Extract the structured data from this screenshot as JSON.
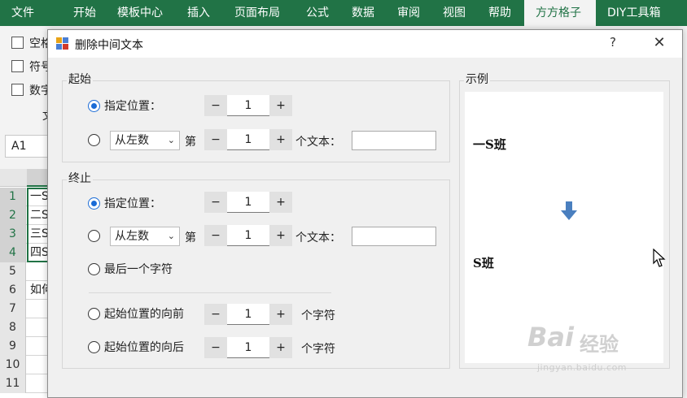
{
  "ribbon": {
    "tabs": [
      {
        "label": "文件",
        "active": false
      },
      {
        "label": "开始",
        "active": false
      },
      {
        "label": "模板中心",
        "active": false
      },
      {
        "label": "插入",
        "active": false
      },
      {
        "label": "页面布局",
        "active": false
      },
      {
        "label": "公式",
        "active": false
      },
      {
        "label": "数据",
        "active": false
      },
      {
        "label": "审阅",
        "active": false
      },
      {
        "label": "视图",
        "active": false
      },
      {
        "label": "帮助",
        "active": false
      },
      {
        "label": "方方格子",
        "active": true
      },
      {
        "label": "DIY工具箱",
        "active": false
      }
    ]
  },
  "excel_bg": {
    "checkbox_labels": [
      "空格",
      "符号",
      "数字"
    ],
    "group_label_fragment": "文",
    "name_box": "A1",
    "rows": [
      {
        "num": "1",
        "cell": "一S"
      },
      {
        "num": "2",
        "cell": "二S"
      },
      {
        "num": "3",
        "cell": "三S"
      },
      {
        "num": "4",
        "cell": "四S"
      },
      {
        "num": "5",
        "cell": ""
      },
      {
        "num": "6",
        "cell": "如何"
      },
      {
        "num": "7",
        "cell": ""
      },
      {
        "num": "8",
        "cell": ""
      },
      {
        "num": "9",
        "cell": ""
      },
      {
        "num": "10",
        "cell": ""
      },
      {
        "num": "11",
        "cell": ""
      }
    ]
  },
  "dialog": {
    "title": "删除中间文本",
    "help": "?",
    "close": "✕",
    "start": {
      "group_label": "起始",
      "opt_position_label": "指定位置：",
      "opt_position_value": "1",
      "combo_value": "从左数",
      "di_label": "第",
      "opt_nth_value": "1",
      "unit_label": "个文本：",
      "text_value": ""
    },
    "end": {
      "group_label": "终止",
      "opt_position_label": "指定位置：",
      "opt_position_value": "1",
      "combo_value": "从左数",
      "di_label": "第",
      "opt_nth_value": "1",
      "unit_label": "个文本：",
      "text_value": "",
      "last_char_label": "最后一个字符",
      "before_label": "起始位置的向前",
      "before_value": "1",
      "after_label": "起始位置的向后",
      "after_value": "1",
      "chars_label": "个字符"
    },
    "example": {
      "group_label": "示例",
      "before": "一S班",
      "after": "S班"
    },
    "spin_minus": "−",
    "spin_plus": "+"
  },
  "watermark": {
    "brand": "Bai",
    "cn": "经验",
    "url": "jingyan.baidu.com"
  }
}
